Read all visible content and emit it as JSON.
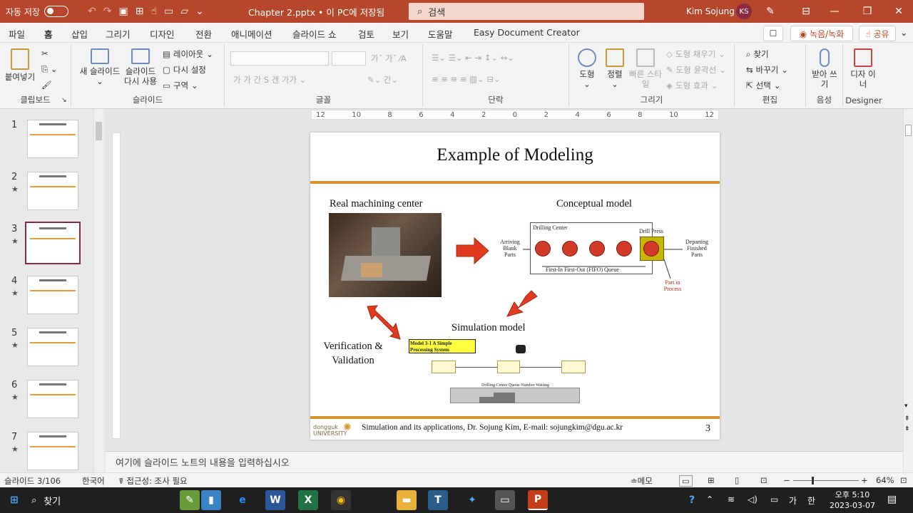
{
  "titlebar": {
    "autosave_label": "자동 저장",
    "autosave_state": "끔",
    "doc_title": "Chapter 2.pptx • 이 PC에 저장됨",
    "search_placeholder": "검색",
    "user_name": "Kim Sojung",
    "user_initials": "KS"
  },
  "menu": {
    "tabs": [
      "파일",
      "홈",
      "삽입",
      "그리기",
      "디자인",
      "전환",
      "애니메이션",
      "슬라이드 쇼",
      "검토",
      "보기",
      "도움말",
      "Easy Document Creator"
    ],
    "active": "홈",
    "record": "◉ 녹음/녹화",
    "share": "☝ 공유"
  },
  "ribbon": {
    "clipboard": {
      "label": "클립보드",
      "paste": "붙여넣기"
    },
    "slides": {
      "label": "슬라이드",
      "new_slide": "새 슬라이드",
      "reuse": "슬라이드 다시 사용",
      "layout": "레이아웃",
      "reset": "다시 설정",
      "section": "구역"
    },
    "font": {
      "label": "글꼴"
    },
    "paragraph": {
      "label": "단락"
    },
    "drawing": {
      "label": "그리기",
      "shape": "도형",
      "arrange": "정렬",
      "quick_style": "빠른 스타일",
      "fill": "도형 채우기",
      "outline": "도형 윤곽선",
      "effect": "도형 효과"
    },
    "editing": {
      "label": "편집",
      "find": "찾기",
      "replace": "바꾸기",
      "select": "선택"
    },
    "voice": {
      "label": "음성",
      "dictate": "받아 쓰기"
    },
    "designer": {
      "label": "Designer",
      "button": "디자 이너"
    }
  },
  "ruler": {
    "h_ticks": [
      "12",
      "10",
      "8",
      "6",
      "4",
      "2",
      "0",
      "2",
      "4",
      "6",
      "8",
      "10",
      "12"
    ]
  },
  "thumbnails": [
    {
      "num": "1",
      "star": ""
    },
    {
      "num": "2",
      "star": "★"
    },
    {
      "num": "3",
      "star": "★"
    },
    {
      "num": "4",
      "star": "★"
    },
    {
      "num": "5",
      "star": "★"
    },
    {
      "num": "6",
      "star": "★"
    },
    {
      "num": "7",
      "star": "★"
    }
  ],
  "slide": {
    "title": "Example of Modeling",
    "real_label": "Real machining center",
    "concept_label": "Conceptual model",
    "sim_label": "Simulation model",
    "verif_label": "Verification & Validation",
    "drilling_center": "Drilling Center",
    "drill_press": "Drill Press",
    "arriving": "Arriving Blank Parts",
    "departing": "Departing Finished Parts",
    "queue": "First-In First-Out (FIFO) Queue",
    "part_in_process": "Part in Process",
    "sim_box_title": "Model 3-1 A Simple Processing System",
    "sim_chart_title": "Drilling Center Queue Number Waiting",
    "footer_text": "Simulation and its applications, Dr. Sojung Kim, E-mail: sojungkim@dgu.ac.kr",
    "footer_logo": "dongguk UNIVERSITY",
    "page_num": "3",
    "accent": "#d4952b"
  },
  "notes_placeholder": "여기에 슬라이드 노트의 내용을 입력하십시오",
  "status": {
    "slide_pos": "슬라이드 3/106",
    "language": "한국어",
    "accessibility": "접근성: 조사 필요",
    "notes_btn": "≐메모",
    "zoom": "64%"
  },
  "taskbar": {
    "search": "찾기",
    "time": "오후 5:10",
    "date": "2023-03-07",
    "ime_lang": "가",
    "ime_mode": "한"
  },
  "colors": {
    "ppt_red": "#b7472a",
    "selected_border": "#8b2942"
  }
}
